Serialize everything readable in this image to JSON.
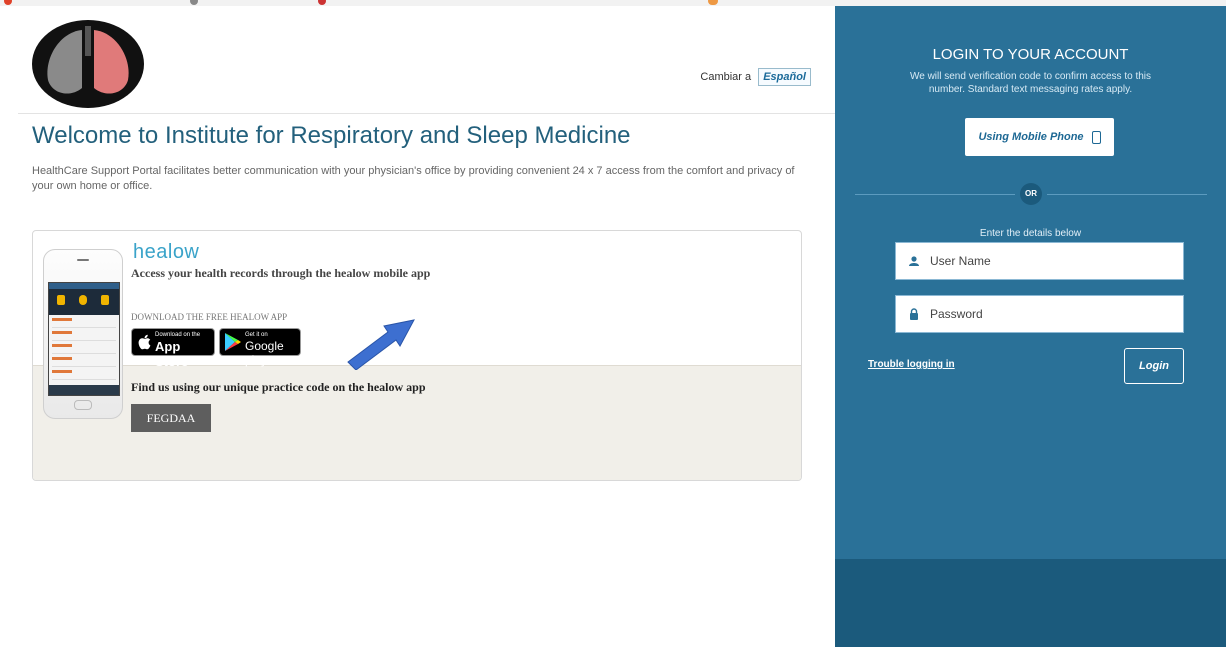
{
  "header": {
    "lang_label": "Cambiar a",
    "lang_button": "Español",
    "title": "Welcome to Institute for Respiratory and Sleep Medicine",
    "description": "HealthCare Support Portal facilitates better communication with your physician's office by providing convenient 24 x 7 access from the comfort and privacy of your own home or office."
  },
  "healow_card": {
    "brand": "healow",
    "tagline": "Access your health records through the healow mobile app",
    "download_label": "DOWNLOAD THE FREE HEALOW APP",
    "app_store_small": "Download on the",
    "app_store_big": "App Store",
    "google_play_small": "Get it on",
    "google_play_big": "Google play",
    "practice_text": "Find us using our unique practice code on the healow app",
    "practice_code": "FEGDAA"
  },
  "login_panel": {
    "title": "LOGIN TO YOUR ACCOUNT",
    "subtitle": "We will send verification code to confirm access to this number. Standard text messaging rates apply.",
    "mobile_button": "Using Mobile Phone",
    "or_label": "OR",
    "enter_details": "Enter the details below",
    "username_placeholder": "User Name",
    "password_placeholder": "Password",
    "trouble_link": "Trouble logging in",
    "login_button": "Login"
  },
  "colors": {
    "panel": "#2a7198",
    "panel_footer": "#1b5a7c",
    "title": "#23607c",
    "healow": "#3aa3c9",
    "arrow": "#3d6fd0"
  }
}
